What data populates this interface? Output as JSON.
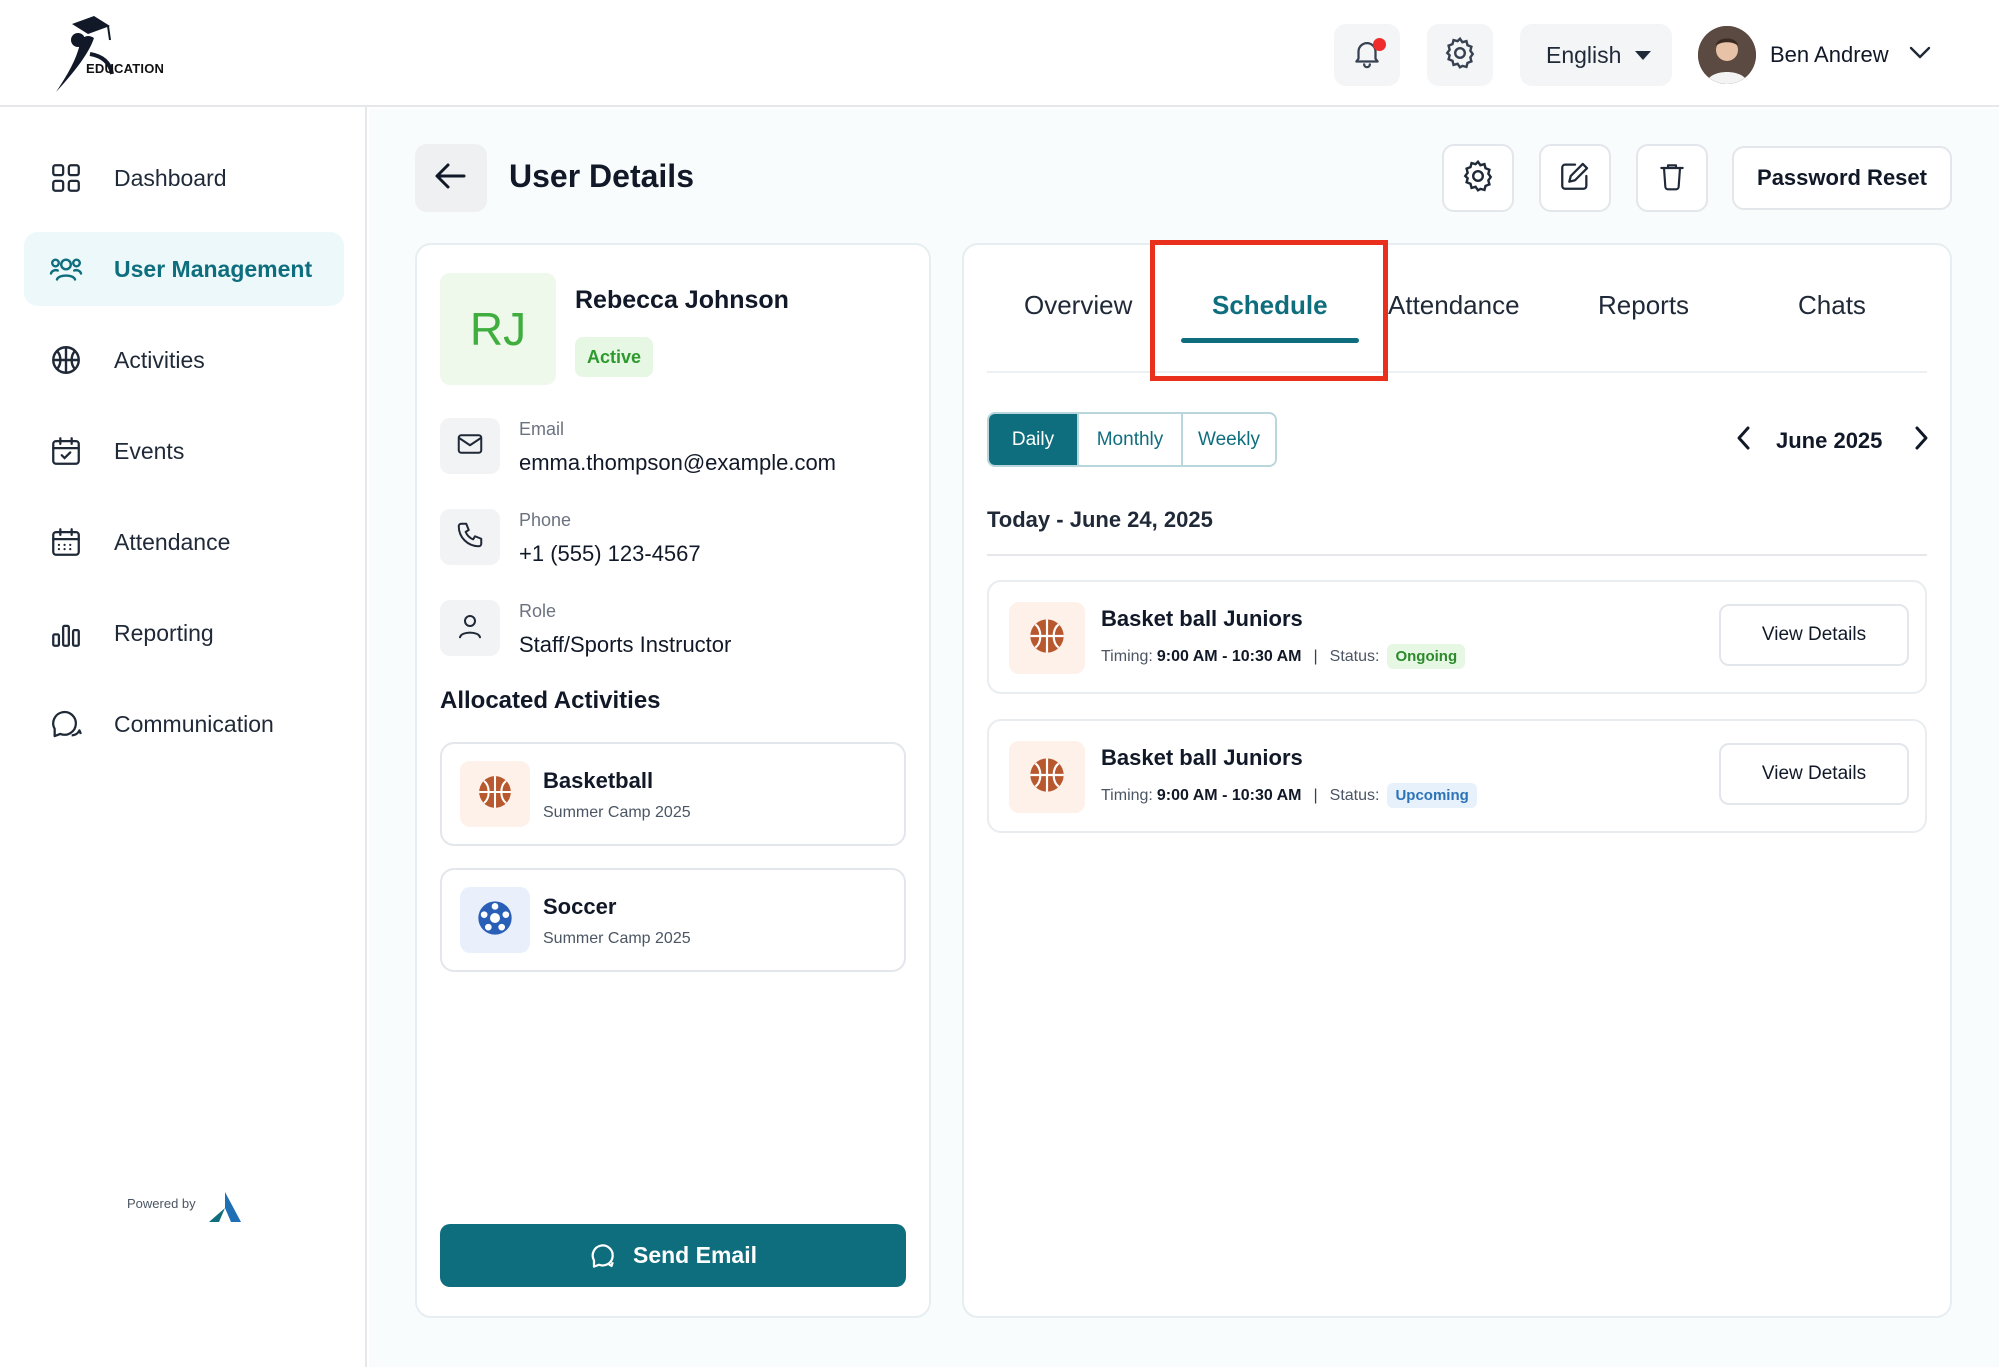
{
  "header": {
    "logo_text": "EDUCATION",
    "language": "English",
    "user_name": "Ben Andrew",
    "colors": {
      "accent": "#0f6e7e",
      "notification_dot": "#ef2b2b"
    }
  },
  "sidebar": {
    "items": [
      {
        "label": "Dashboard",
        "icon": "grid-icon",
        "active": false
      },
      {
        "label": "User Management",
        "icon": "users-icon",
        "active": true
      },
      {
        "label": "Activities",
        "icon": "ball-icon",
        "active": false
      },
      {
        "label": "Events",
        "icon": "calendar-check-icon",
        "active": false
      },
      {
        "label": "Attendance",
        "icon": "calendar-icon",
        "active": false
      },
      {
        "label": "Reporting",
        "icon": "bar-chart-icon",
        "active": false
      },
      {
        "label": "Communication",
        "icon": "chat-icon",
        "active": false
      }
    ],
    "powered_by": "Powered by"
  },
  "page": {
    "title": "User Details",
    "password_reset": "Password Reset"
  },
  "profile": {
    "initials": "RJ",
    "name": "Rebecca Johnson",
    "status": "Active",
    "email_label": "Email",
    "email": "emma.thompson@example.com",
    "phone_label": "Phone",
    "phone": "+1 (555) 123-4567",
    "role_label": "Role",
    "role": "Staff/Sports Instructor",
    "allocated_title": "Allocated Activities",
    "activities": [
      {
        "name": "Basketball",
        "sub": "Summer Camp 2025",
        "icon": "basketball-icon"
      },
      {
        "name": "Soccer",
        "sub": "Summer Camp 2025",
        "icon": "soccer-ball-icon"
      }
    ],
    "send_email": "Send Email"
  },
  "schedule": {
    "tabs": [
      "Overview",
      "Schedule",
      "Attendance",
      "Reports",
      "Chats"
    ],
    "active_tab": "Schedule",
    "views": [
      "Daily",
      "Monthly",
      "Weekly"
    ],
    "active_view": "Daily",
    "month": "June 2025",
    "today": "Today - June 24, 2025",
    "items": [
      {
        "title": "Basket ball Juniors",
        "timing_label": "Timing:",
        "timing": "9:00 AM - 10:30 AM",
        "status_label": "Status:",
        "status": "Ongoing",
        "action": "View Details"
      },
      {
        "title": "Basket ball Juniors",
        "timing_label": "Timing:",
        "timing": "9:00 AM - 10:30 AM",
        "status_label": "Status:",
        "status": "Upcoming",
        "action": "View Details"
      }
    ]
  }
}
